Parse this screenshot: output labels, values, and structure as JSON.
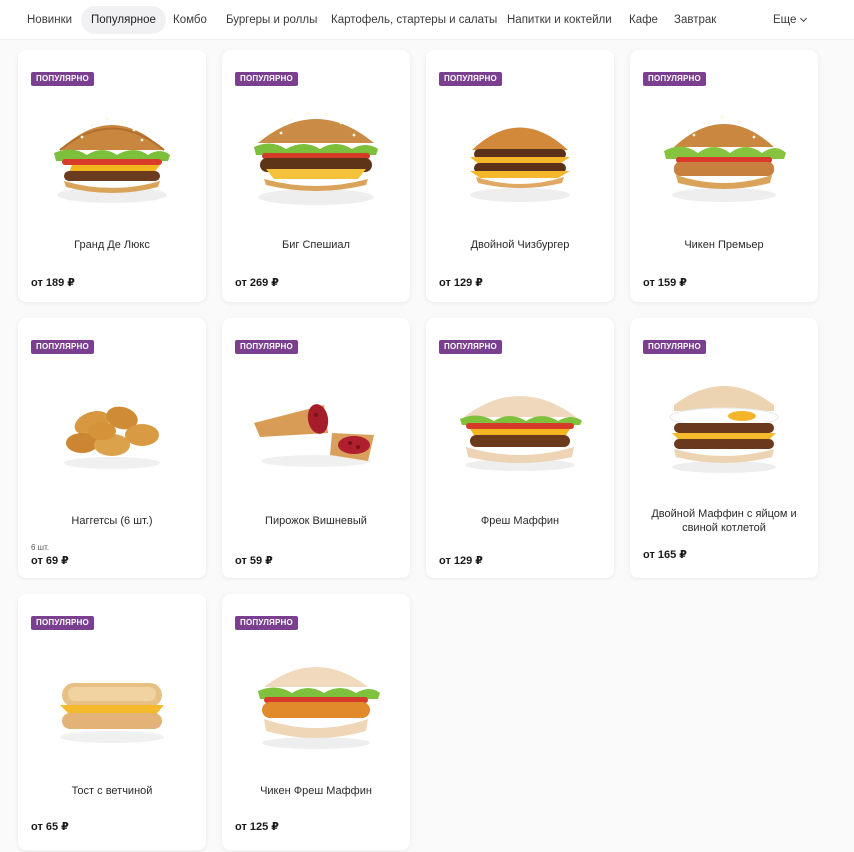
{
  "nav": {
    "items": [
      "Новинки",
      "Популярное",
      "Комбо",
      "Бургеры и роллы",
      "Картофель, стартеры и салаты",
      "Напитки и коктейли",
      "Кафе",
      "Завтрак"
    ],
    "more": "Еще"
  },
  "badge": "ПОПУЛЯРНО",
  "products": [
    {
      "name": "Гранд Де Люкс",
      "price": "от 189 ₽",
      "icon": "burger-icon"
    },
    {
      "name": "Биг Спешиал",
      "price": "от 269 ₽",
      "icon": "burger-icon"
    },
    {
      "name": "Двойной Чизбургер",
      "price": "от 129 ₽",
      "icon": "cheeseburger-icon"
    },
    {
      "name": "Чикен Премьер",
      "price": "от 159 ₽",
      "icon": "chicken-burger-icon"
    },
    {
      "name": "Наггетсы (6 шт.)",
      "note": "6 шт.",
      "price": "от 69 ₽",
      "icon": "nuggets-icon"
    },
    {
      "name": "Пирожок Вишневый",
      "price": "от 59 ₽",
      "icon": "cherry-pie-icon"
    },
    {
      "name": "Фреш Маффин",
      "price": "от 129 ₽",
      "icon": "muffin-icon"
    },
    {
      "name": "Двойной Маффин с яйцом и свиной котлетой",
      "price": "от 165 ₽",
      "icon": "egg-muffin-icon"
    },
    {
      "name": "Тост с ветчиной",
      "price": "от 65 ₽",
      "icon": "toast-icon"
    },
    {
      "name": "Чикен Фреш Маффин",
      "price": "от 125 ₽",
      "icon": "chicken-muffin-icon"
    }
  ]
}
